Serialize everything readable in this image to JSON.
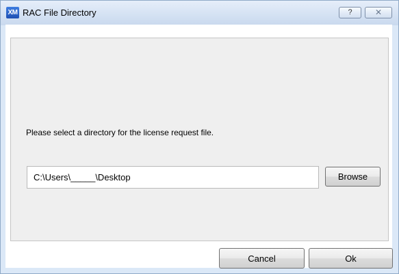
{
  "window": {
    "title": "RAC File Directory",
    "app_icon_text": "XM",
    "help_label": "?",
    "close_label": "✕"
  },
  "dialog": {
    "prompt": "Please select a directory for the license request file.",
    "path_value": "C:\\Users\\_____\\Desktop",
    "browse_label": "Browse",
    "cancel_label": "Cancel",
    "ok_label": "Ok"
  },
  "colors": {
    "frame": "#dbe8f7",
    "panel": "#efefef",
    "app_icon": "#2a5fc8"
  }
}
